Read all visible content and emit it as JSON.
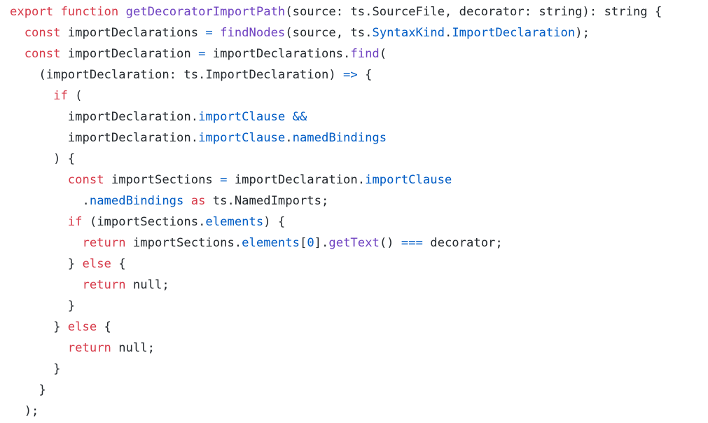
{
  "colors": {
    "background": "#ffffff",
    "keyword": "#d73a49",
    "function": "#6f42c1",
    "property": "#005cc5",
    "operator": "#005cc5",
    "plain": "#24292e"
  },
  "code": {
    "lines": [
      {
        "indent": "",
        "tokens": [
          {
            "t": "export",
            "k": "kw"
          },
          {
            "t": " ",
            "k": "plain"
          },
          {
            "t": "function",
            "k": "kw"
          },
          {
            "t": " ",
            "k": "plain"
          },
          {
            "t": "getDecoratorImportPath",
            "k": "fn"
          },
          {
            "t": "(source: ts.SourceFile, decorator: string): string {",
            "k": "plain"
          }
        ]
      },
      {
        "indent": "  ",
        "tokens": [
          {
            "t": "const",
            "k": "kw"
          },
          {
            "t": " importDeclarations ",
            "k": "plain"
          },
          {
            "t": "=",
            "k": "op"
          },
          {
            "t": " ",
            "k": "plain"
          },
          {
            "t": "findNodes",
            "k": "fn"
          },
          {
            "t": "(source, ts.",
            "k": "plain"
          },
          {
            "t": "SyntaxKind",
            "k": "prop"
          },
          {
            "t": ".",
            "k": "plain"
          },
          {
            "t": "ImportDeclaration",
            "k": "prop"
          },
          {
            "t": ");",
            "k": "plain"
          }
        ]
      },
      {
        "indent": "  ",
        "tokens": [
          {
            "t": "const",
            "k": "kw"
          },
          {
            "t": " importDeclaration ",
            "k": "plain"
          },
          {
            "t": "=",
            "k": "op"
          },
          {
            "t": " importDeclarations.",
            "k": "plain"
          },
          {
            "t": "find",
            "k": "fn"
          },
          {
            "t": "(",
            "k": "plain"
          }
        ]
      },
      {
        "indent": "    ",
        "tokens": [
          {
            "t": "(importDeclaration: ts.ImportDeclaration) ",
            "k": "plain"
          },
          {
            "t": "=>",
            "k": "op"
          },
          {
            "t": " {",
            "k": "plain"
          }
        ]
      },
      {
        "indent": "      ",
        "tokens": [
          {
            "t": "if",
            "k": "kw"
          },
          {
            "t": " (",
            "k": "plain"
          }
        ]
      },
      {
        "indent": "        ",
        "tokens": [
          {
            "t": "importDeclaration.",
            "k": "plain"
          },
          {
            "t": "importClause",
            "k": "prop"
          },
          {
            "t": " ",
            "k": "plain"
          },
          {
            "t": "&&",
            "k": "op"
          }
        ]
      },
      {
        "indent": "        ",
        "tokens": [
          {
            "t": "importDeclaration.",
            "k": "plain"
          },
          {
            "t": "importClause",
            "k": "prop"
          },
          {
            "t": ".",
            "k": "plain"
          },
          {
            "t": "namedBindings",
            "k": "prop"
          }
        ]
      },
      {
        "indent": "      ",
        "tokens": [
          {
            "t": ") {",
            "k": "plain"
          }
        ]
      },
      {
        "indent": "        ",
        "tokens": [
          {
            "t": "const",
            "k": "kw"
          },
          {
            "t": " importSections ",
            "k": "plain"
          },
          {
            "t": "=",
            "k": "op"
          },
          {
            "t": " importDeclaration.",
            "k": "plain"
          },
          {
            "t": "importClause",
            "k": "prop"
          }
        ]
      },
      {
        "indent": "          ",
        "tokens": [
          {
            "t": ".",
            "k": "plain"
          },
          {
            "t": "namedBindings",
            "k": "prop"
          },
          {
            "t": " ",
            "k": "plain"
          },
          {
            "t": "as",
            "k": "kw"
          },
          {
            "t": " ts.NamedImports;",
            "k": "plain"
          }
        ]
      },
      {
        "indent": "        ",
        "tokens": [
          {
            "t": "if",
            "k": "kw"
          },
          {
            "t": " (importSections.",
            "k": "plain"
          },
          {
            "t": "elements",
            "k": "prop"
          },
          {
            "t": ") {",
            "k": "plain"
          }
        ]
      },
      {
        "indent": "          ",
        "tokens": [
          {
            "t": "return",
            "k": "kw"
          },
          {
            "t": " importSections.",
            "k": "plain"
          },
          {
            "t": "elements",
            "k": "prop"
          },
          {
            "t": "[",
            "k": "plain"
          },
          {
            "t": "0",
            "k": "prop"
          },
          {
            "t": "].",
            "k": "plain"
          },
          {
            "t": "getText",
            "k": "fn"
          },
          {
            "t": "() ",
            "k": "plain"
          },
          {
            "t": "===",
            "k": "op"
          },
          {
            "t": " decorator;",
            "k": "plain"
          }
        ]
      },
      {
        "indent": "        ",
        "tokens": [
          {
            "t": "} ",
            "k": "plain"
          },
          {
            "t": "else",
            "k": "kw"
          },
          {
            "t": " {",
            "k": "plain"
          }
        ]
      },
      {
        "indent": "          ",
        "tokens": [
          {
            "t": "return",
            "k": "kw"
          },
          {
            "t": " null;",
            "k": "plain"
          }
        ]
      },
      {
        "indent": "        ",
        "tokens": [
          {
            "t": "}",
            "k": "plain"
          }
        ]
      },
      {
        "indent": "      ",
        "tokens": [
          {
            "t": "} ",
            "k": "plain"
          },
          {
            "t": "else",
            "k": "kw"
          },
          {
            "t": " {",
            "k": "plain"
          }
        ]
      },
      {
        "indent": "        ",
        "tokens": [
          {
            "t": "return",
            "k": "kw"
          },
          {
            "t": " null;",
            "k": "plain"
          }
        ]
      },
      {
        "indent": "      ",
        "tokens": [
          {
            "t": "}",
            "k": "plain"
          }
        ]
      },
      {
        "indent": "    ",
        "tokens": [
          {
            "t": "}",
            "k": "plain"
          }
        ]
      },
      {
        "indent": "  ",
        "tokens": [
          {
            "t": ");",
            "k": "plain"
          }
        ]
      }
    ]
  }
}
